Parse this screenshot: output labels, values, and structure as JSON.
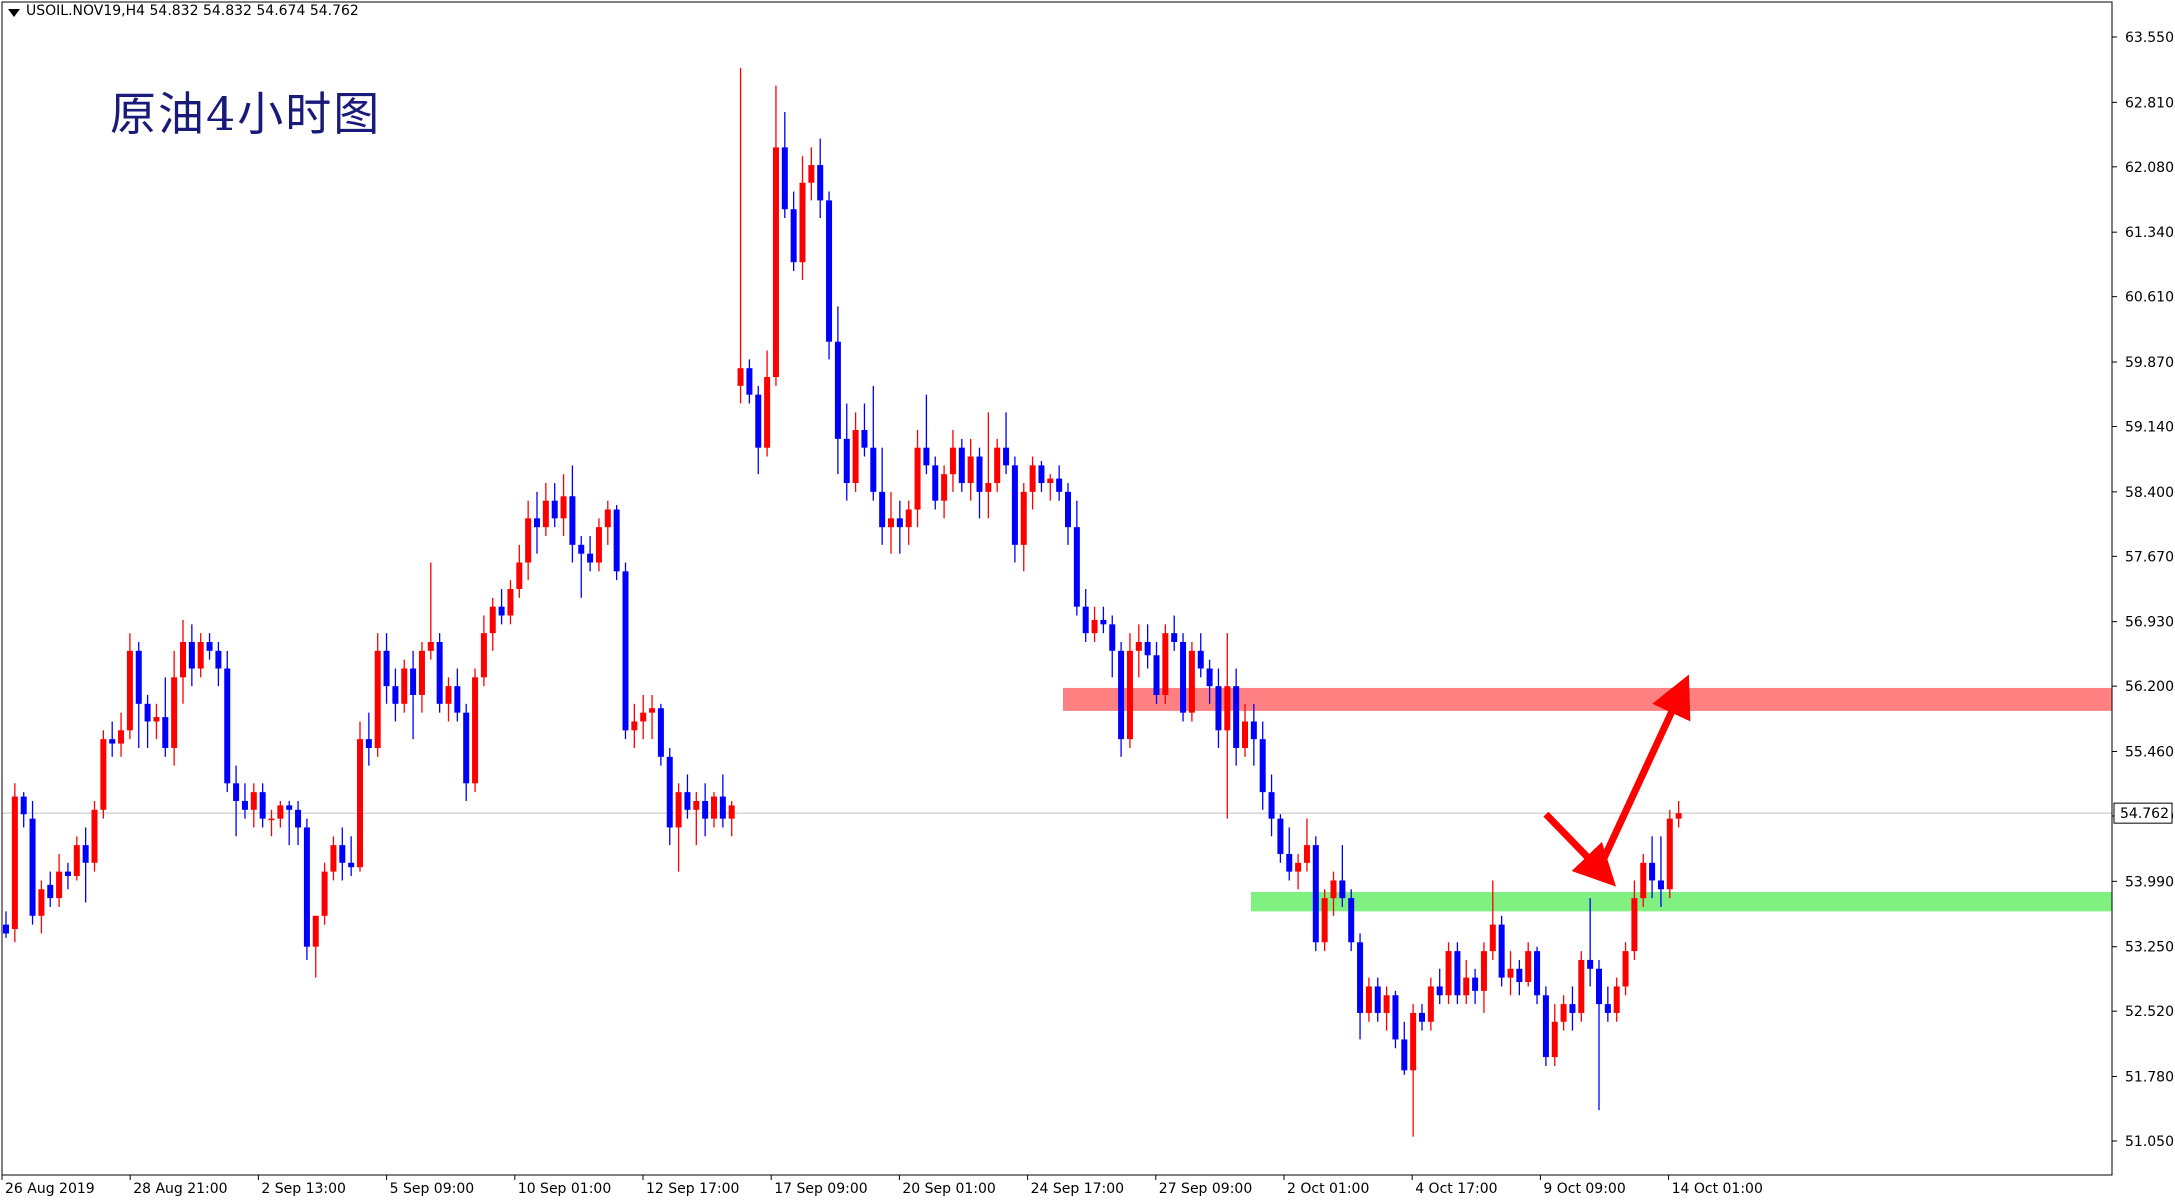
{
  "header": {
    "symbol_line": "USOIL.NOV19,H4  54.832 54.832 54.674 54.762"
  },
  "annotation": {
    "title": "原油4小时图"
  },
  "colors": {
    "bull": "#ff0000",
    "bear": "#0000ff",
    "resistance_zone": "#ff8080",
    "support_zone": "#80f080",
    "arrow": "#ff0000",
    "grid": "#000000",
    "price_line": "#c0c0c0"
  },
  "chart_data": {
    "type": "candlestick",
    "title": "原油4小时图",
    "symbol": "USOIL.NOV19",
    "timeframe": "H4",
    "ohlc_header": {
      "open": 54.832,
      "high": 54.832,
      "low": 54.674,
      "close": 54.762
    },
    "current_price_label": "54.762",
    "y_ticks": [
      "63.550",
      "62.810",
      "62.080",
      "61.340",
      "60.610",
      "59.870",
      "59.140",
      "58.400",
      "57.670",
      "56.930",
      "56.200",
      "55.460",
      "54.730",
      "53.990",
      "53.250",
      "52.520",
      "51.780",
      "51.050"
    ],
    "x_ticks": [
      "26 Aug 2019",
      "28 Aug 21:00",
      "2 Sep 13:00",
      "5 Sep 09:00",
      "10 Sep 01:00",
      "12 Sep 17:00",
      "17 Sep 09:00",
      "20 Sep 01:00",
      "24 Sep 17:00",
      "27 Sep 09:00",
      "2 Oct 01:00",
      "4 Oct 17:00",
      "9 Oct 09:00",
      "14 Oct 01:00"
    ],
    "ylim": [
      50.85,
      63.8
    ],
    "zones": [
      {
        "name": "resistance",
        "from": 55.92,
        "to": 56.18
      },
      {
        "name": "support",
        "from": 53.65,
        "to": 53.87
      }
    ],
    "projection_path": [
      {
        "bar": 174,
        "price": 54.75
      },
      {
        "bar": 180,
        "price": 54.13
      },
      {
        "bar": 189,
        "price": 56.08
      }
    ],
    "candles": [
      [
        53.5,
        53.65,
        53.35,
        53.4
      ],
      [
        53.45,
        55.1,
        53.3,
        54.95
      ],
      [
        54.95,
        55.0,
        54.6,
        54.75
      ],
      [
        54.7,
        54.9,
        53.5,
        53.6
      ],
      [
        53.6,
        54.0,
        53.4,
        53.9
      ],
      [
        53.95,
        54.1,
        53.7,
        53.8
      ],
      [
        53.8,
        54.3,
        53.7,
        54.1
      ],
      [
        54.1,
        54.2,
        53.9,
        54.05
      ],
      [
        54.05,
        54.5,
        54.0,
        54.4
      ],
      [
        54.4,
        54.6,
        53.75,
        54.2
      ],
      [
        54.2,
        54.9,
        54.1,
        54.8
      ],
      [
        54.8,
        55.7,
        54.7,
        55.6
      ],
      [
        55.6,
        55.8,
        55.4,
        55.55
      ],
      [
        55.55,
        55.9,
        55.4,
        55.7
      ],
      [
        55.7,
        56.8,
        55.6,
        56.6
      ],
      [
        56.6,
        56.7,
        55.5,
        56.0
      ],
      [
        56.0,
        56.1,
        55.5,
        55.8
      ],
      [
        55.8,
        56.0,
        55.6,
        55.85
      ],
      [
        55.85,
        56.3,
        55.4,
        55.5
      ],
      [
        55.5,
        56.6,
        55.3,
        56.3
      ],
      [
        56.3,
        56.95,
        56.0,
        56.7
      ],
      [
        56.7,
        56.9,
        56.2,
        56.4
      ],
      [
        56.4,
        56.8,
        56.3,
        56.7
      ],
      [
        56.7,
        56.8,
        56.5,
        56.6
      ],
      [
        56.6,
        56.7,
        56.2,
        56.4
      ],
      [
        56.4,
        56.6,
        55.0,
        55.1
      ],
      [
        55.1,
        55.3,
        54.5,
        54.9
      ],
      [
        54.9,
        55.1,
        54.7,
        54.8
      ],
      [
        54.8,
        55.1,
        54.6,
        55.0
      ],
      [
        55.0,
        55.1,
        54.6,
        54.7
      ],
      [
        54.7,
        54.8,
        54.5,
        54.7
      ],
      [
        54.7,
        54.9,
        54.6,
        54.85
      ],
      [
        54.85,
        54.9,
        54.4,
        54.8
      ],
      [
        54.8,
        54.9,
        54.4,
        54.6
      ],
      [
        54.6,
        54.7,
        53.1,
        53.25
      ],
      [
        53.25,
        53.6,
        52.9,
        53.6
      ],
      [
        53.6,
        54.2,
        53.5,
        54.1
      ],
      [
        54.1,
        54.5,
        54.0,
        54.4
      ],
      [
        54.4,
        54.6,
        54.0,
        54.2
      ],
      [
        54.2,
        54.5,
        54.05,
        54.15
      ],
      [
        54.15,
        55.8,
        54.1,
        55.6
      ],
      [
        55.6,
        55.9,
        55.3,
        55.5
      ],
      [
        55.5,
        56.8,
        55.4,
        56.6
      ],
      [
        56.6,
        56.8,
        56.0,
        56.2
      ],
      [
        56.2,
        56.4,
        55.8,
        56.0
      ],
      [
        56.0,
        56.5,
        55.9,
        56.4
      ],
      [
        56.4,
        56.6,
        55.6,
        56.1
      ],
      [
        56.1,
        56.7,
        55.9,
        56.6
      ],
      [
        56.6,
        57.6,
        56.5,
        56.7
      ],
      [
        56.7,
        56.8,
        55.9,
        56.0
      ],
      [
        56.0,
        56.3,
        55.8,
        56.2
      ],
      [
        56.2,
        56.4,
        55.8,
        55.9
      ],
      [
        55.9,
        56.0,
        54.9,
        55.1
      ],
      [
        55.1,
        56.4,
        55.0,
        56.3
      ],
      [
        56.3,
        57.0,
        56.2,
        56.8
      ],
      [
        56.8,
        57.2,
        56.6,
        57.1
      ],
      [
        57.1,
        57.3,
        56.9,
        57.0
      ],
      [
        57.0,
        57.4,
        56.9,
        57.3
      ],
      [
        57.3,
        57.8,
        57.2,
        57.6
      ],
      [
        57.6,
        58.3,
        57.4,
        58.1
      ],
      [
        58.1,
        58.4,
        57.7,
        58.0
      ],
      [
        58.0,
        58.5,
        57.9,
        58.3
      ],
      [
        58.3,
        58.5,
        58.0,
        58.1
      ],
      [
        58.1,
        58.6,
        57.9,
        58.35
      ],
      [
        58.35,
        58.7,
        57.6,
        57.8
      ],
      [
        57.8,
        57.9,
        57.2,
        57.7
      ],
      [
        57.7,
        57.9,
        57.5,
        57.6
      ],
      [
        57.6,
        58.1,
        57.5,
        58.0
      ],
      [
        58.0,
        58.3,
        57.8,
        58.2
      ],
      [
        58.2,
        58.25,
        57.4,
        57.5
      ],
      [
        57.5,
        57.6,
        55.6,
        55.7
      ],
      [
        55.7,
        56.0,
        55.5,
        55.8
      ],
      [
        55.8,
        56.1,
        55.6,
        55.9
      ],
      [
        55.9,
        56.1,
        55.6,
        55.95
      ],
      [
        55.95,
        56.0,
        55.3,
        55.4
      ],
      [
        55.4,
        55.5,
        54.4,
        54.6
      ],
      [
        54.6,
        55.1,
        54.1,
        55.0
      ],
      [
        55.0,
        55.2,
        54.7,
        54.8
      ],
      [
        54.8,
        55.0,
        54.4,
        54.9
      ],
      [
        54.9,
        55.1,
        54.5,
        54.7
      ],
      [
        54.7,
        55.0,
        54.6,
        54.95
      ],
      [
        54.95,
        55.2,
        54.6,
        54.7
      ],
      [
        54.7,
        54.9,
        54.5,
        54.85
      ],
      [
        59.6,
        63.2,
        59.4,
        59.8
      ],
      [
        59.8,
        59.9,
        59.4,
        59.5
      ],
      [
        59.5,
        59.6,
        58.6,
        58.9
      ],
      [
        58.9,
        60.0,
        58.8,
        59.7
      ],
      [
        59.7,
        63.0,
        59.6,
        62.3
      ],
      [
        62.3,
        62.7,
        61.5,
        61.6
      ],
      [
        61.6,
        61.8,
        60.9,
        61.0
      ],
      [
        61.0,
        62.2,
        60.8,
        61.9
      ],
      [
        61.9,
        62.3,
        61.7,
        62.1
      ],
      [
        62.1,
        62.4,
        61.5,
        61.7
      ],
      [
        61.7,
        61.8,
        59.9,
        60.1
      ],
      [
        60.1,
        60.5,
        58.6,
        59.0
      ],
      [
        59.0,
        59.4,
        58.3,
        58.5
      ],
      [
        58.5,
        59.3,
        58.4,
        59.1
      ],
      [
        59.1,
        59.4,
        58.8,
        58.9
      ],
      [
        58.9,
        59.6,
        58.3,
        58.4
      ],
      [
        58.4,
        58.9,
        57.8,
        58.0
      ],
      [
        58.0,
        58.4,
        57.7,
        58.1
      ],
      [
        58.1,
        58.3,
        57.7,
        58.0
      ],
      [
        58.0,
        58.3,
        57.8,
        58.2
      ],
      [
        58.2,
        59.1,
        58.0,
        58.9
      ],
      [
        58.9,
        59.5,
        58.6,
        58.7
      ],
      [
        58.7,
        58.8,
        58.2,
        58.3
      ],
      [
        58.3,
        58.7,
        58.1,
        58.6
      ],
      [
        58.6,
        59.1,
        58.4,
        58.9
      ],
      [
        58.9,
        59.0,
        58.4,
        58.5
      ],
      [
        58.5,
        59.0,
        58.3,
        58.8
      ],
      [
        58.8,
        58.9,
        58.1,
        58.4
      ],
      [
        58.4,
        59.3,
        58.1,
        58.5
      ],
      [
        58.5,
        59.0,
        58.4,
        58.9
      ],
      [
        58.9,
        59.3,
        58.6,
        58.7
      ],
      [
        58.7,
        58.8,
        57.6,
        57.8
      ],
      [
        57.8,
        58.5,
        57.5,
        58.4
      ],
      [
        58.4,
        58.8,
        58.2,
        58.7
      ],
      [
        58.7,
        58.75,
        58.4,
        58.5
      ],
      [
        58.5,
        58.6,
        58.3,
        58.55
      ],
      [
        58.55,
        58.7,
        58.3,
        58.4
      ],
      [
        58.4,
        58.5,
        57.8,
        58.0
      ],
      [
        58.0,
        58.3,
        57.0,
        57.1
      ],
      [
        57.1,
        57.3,
        56.7,
        56.8
      ],
      [
        56.8,
        57.1,
        56.7,
        56.95
      ],
      [
        56.95,
        57.1,
        56.8,
        56.9
      ],
      [
        56.9,
        57.0,
        56.3,
        56.6
      ],
      [
        56.6,
        56.7,
        55.4,
        55.6
      ],
      [
        55.6,
        56.8,
        55.5,
        56.6
      ],
      [
        56.6,
        56.9,
        56.3,
        56.7
      ],
      [
        56.7,
        56.9,
        56.4,
        56.55
      ],
      [
        56.55,
        56.7,
        56.0,
        56.1
      ],
      [
        56.1,
        56.9,
        56.0,
        56.8
      ],
      [
        56.8,
        57.0,
        56.6,
        56.7
      ],
      [
        56.7,
        56.8,
        55.8,
        55.9
      ],
      [
        55.9,
        56.7,
        55.8,
        56.6
      ],
      [
        56.6,
        56.8,
        56.3,
        56.4
      ],
      [
        56.4,
        56.5,
        56.0,
        56.2
      ],
      [
        56.2,
        56.4,
        55.5,
        55.7
      ],
      [
        55.7,
        56.8,
        54.7,
        56.2
      ],
      [
        56.2,
        56.4,
        55.3,
        55.5
      ],
      [
        55.5,
        56.0,
        55.4,
        55.8
      ],
      [
        55.8,
        56.0,
        55.3,
        55.6
      ],
      [
        55.6,
        55.8,
        54.8,
        55.0
      ],
      [
        55.0,
        55.2,
        54.5,
        54.7
      ],
      [
        54.7,
        54.75,
        54.2,
        54.3
      ],
      [
        54.3,
        54.6,
        54.0,
        54.1
      ],
      [
        54.1,
        54.3,
        53.9,
        54.2
      ],
      [
        54.2,
        54.7,
        54.1,
        54.4
      ],
      [
        54.4,
        54.5,
        53.2,
        53.3
      ],
      [
        53.3,
        53.9,
        53.2,
        53.8
      ],
      [
        53.8,
        54.1,
        53.6,
        54.0
      ],
      [
        54.0,
        54.4,
        53.7,
        53.8
      ],
      [
        53.8,
        53.9,
        53.2,
        53.3
      ],
      [
        53.3,
        53.4,
        52.2,
        52.5
      ],
      [
        52.5,
        52.9,
        52.4,
        52.8
      ],
      [
        52.8,
        52.9,
        52.4,
        52.5
      ],
      [
        52.5,
        52.8,
        52.3,
        52.7
      ],
      [
        52.7,
        52.75,
        52.1,
        52.2
      ],
      [
        52.2,
        52.4,
        51.8,
        51.85
      ],
      [
        51.85,
        52.6,
        51.1,
        52.5
      ],
      [
        52.5,
        52.6,
        52.3,
        52.4
      ],
      [
        52.4,
        52.9,
        52.3,
        52.8
      ],
      [
        52.8,
        53.0,
        52.6,
        52.7
      ],
      [
        52.7,
        53.3,
        52.6,
        53.2
      ],
      [
        53.2,
        53.3,
        52.6,
        52.7
      ],
      [
        52.7,
        53.1,
        52.6,
        52.9
      ],
      [
        52.9,
        53.0,
        52.6,
        52.75
      ],
      [
        52.75,
        53.3,
        52.5,
        53.2
      ],
      [
        53.2,
        54.0,
        53.1,
        53.5
      ],
      [
        53.5,
        53.6,
        52.8,
        52.9
      ],
      [
        52.9,
        53.2,
        52.7,
        53.0
      ],
      [
        53.0,
        53.1,
        52.7,
        52.85
      ],
      [
        52.85,
        53.3,
        52.8,
        53.2
      ],
      [
        53.2,
        53.25,
        52.6,
        52.7
      ],
      [
        52.7,
        52.8,
        51.9,
        52.0
      ],
      [
        52.0,
        52.6,
        51.9,
        52.4
      ],
      [
        52.4,
        52.7,
        52.3,
        52.6
      ],
      [
        52.6,
        52.8,
        52.3,
        52.5
      ],
      [
        52.5,
        53.2,
        52.4,
        53.1
      ],
      [
        53.1,
        53.8,
        52.8,
        53.0
      ],
      [
        53.0,
        53.1,
        51.4,
        52.6
      ],
      [
        52.6,
        52.8,
        52.4,
        52.5
      ],
      [
        52.5,
        52.9,
        52.4,
        52.8
      ],
      [
        52.8,
        53.3,
        52.7,
        53.2
      ],
      [
        53.2,
        54.0,
        53.1,
        53.8
      ],
      [
        53.8,
        54.3,
        53.7,
        54.2
      ],
      [
        54.2,
        54.5,
        53.8,
        54.0
      ],
      [
        54.0,
        54.5,
        53.7,
        53.9
      ],
      [
        53.9,
        54.8,
        53.8,
        54.7
      ],
      [
        54.7,
        54.9,
        54.6,
        54.762
      ]
    ]
  }
}
